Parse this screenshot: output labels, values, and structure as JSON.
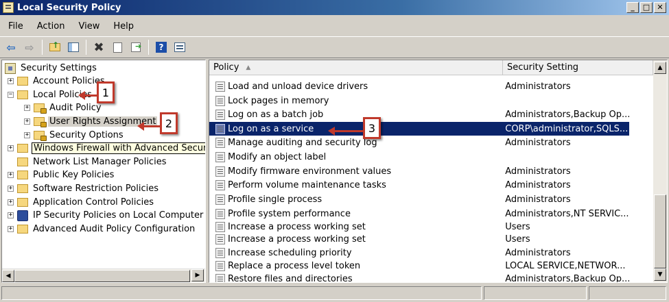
{
  "window": {
    "title": "Local Security Policy",
    "minimize": "_",
    "maximize": "□",
    "close": "✕"
  },
  "menu": [
    "File",
    "Action",
    "View",
    "Help"
  ],
  "tree": {
    "root": "Security Settings",
    "account_policies": "Account Policies",
    "local_policies": "Local Policies",
    "audit_policy": "Audit Policy",
    "user_rights_assignment": "User Rights Assignment",
    "security_options": "Security Options",
    "windows_firewall": "Windows Firewall with Advanced Security",
    "network_list_manager": "Network List Manager Policies",
    "public_key": "Public Key Policies",
    "software_restriction": "Software Restriction Policies",
    "application_control": "Application Control Policies",
    "ip_security": "IP Security Policies on Local Computer",
    "advanced_audit": "Advanced Audit Policy Configuration",
    "expander_plus": "+",
    "expander_minus": "−"
  },
  "list": {
    "col_policy": "Policy",
    "col_setting": "Security Setting",
    "rows": [
      {
        "policy": "Load and unload device drivers",
        "setting": "Administrators"
      },
      {
        "policy": "Lock pages in memory",
        "setting": ""
      },
      {
        "policy": "Log on as a batch job",
        "setting": "Administrators,Backup Op..."
      },
      {
        "policy": "Log on as a service",
        "setting": "CORP\\administrator,SQLS..."
      },
      {
        "policy": "Manage auditing and security log",
        "setting": "Administrators"
      },
      {
        "policy": "Modify an object label",
        "setting": ""
      },
      {
        "policy": "Modify firmware environment values",
        "setting": "Administrators"
      },
      {
        "policy": "Perform volume maintenance tasks",
        "setting": "Administrators"
      },
      {
        "policy": "Profile single process",
        "setting": "Administrators"
      },
      {
        "policy": "Profile system performance",
        "setting": "Administrators,NT SERVIC..."
      },
      {
        "policy": "Increase a process working set",
        "setting": "Users"
      },
      {
        "policy": "Increase a process working set",
        "setting": "Users"
      },
      {
        "policy": "Increase scheduling priority",
        "setting": "Administrators"
      },
      {
        "policy": "Replace a process level token",
        "setting": "LOCAL SERVICE,NETWOR..."
      },
      {
        "policy": "Restore files and directories",
        "setting": "Administrators,Backup Op..."
      }
    ],
    "selected_index": 3
  },
  "callouts": [
    "1",
    "2",
    "3"
  ],
  "colors": {
    "selection": "#0a246a",
    "callout": "#c0392b"
  }
}
